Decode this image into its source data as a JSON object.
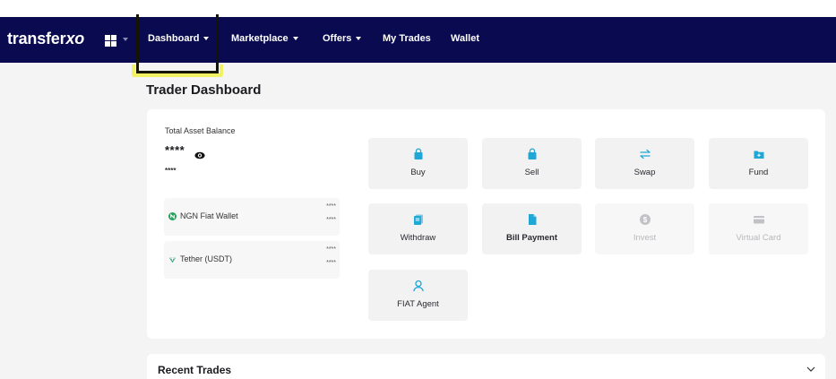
{
  "brand": {
    "name": "transfer",
    "accent": "xo"
  },
  "nav": {
    "items": [
      {
        "label": "Dashboard",
        "dropdown": true
      },
      {
        "label": "Marketplace",
        "dropdown": true
      },
      {
        "label": "Offers",
        "dropdown": true
      },
      {
        "label": "My Trades",
        "dropdown": false
      },
      {
        "label": "Wallet",
        "dropdown": false
      }
    ]
  },
  "page": {
    "title": "Trader Dashboard"
  },
  "balance": {
    "label": "Total Asset Balance",
    "masked_primary": "****",
    "masked_secondary": "****"
  },
  "wallets": [
    {
      "name": "NGN Fiat Wallet",
      "icon": "naira-icon",
      "value1": "****",
      "value2": "****"
    },
    {
      "name": "Tether (USDT)",
      "icon": "tether-icon",
      "value1": "****",
      "value2": "****"
    }
  ],
  "actions": [
    {
      "label": "Buy",
      "icon": "shopping-bag-icon",
      "enabled": true
    },
    {
      "label": "Sell",
      "icon": "shopping-bag-icon",
      "enabled": true
    },
    {
      "label": "Swap",
      "icon": "swap-arrows-icon",
      "enabled": true
    },
    {
      "label": "Fund",
      "icon": "folder-plus-icon",
      "enabled": true
    },
    {
      "label": "Withdraw",
      "icon": "document-stack-icon",
      "enabled": true
    },
    {
      "label": "Bill Payment",
      "icon": "document-icon",
      "enabled": true
    },
    {
      "label": "Invest",
      "icon": "dollar-coin-icon",
      "enabled": false
    },
    {
      "label": "Virtual Card",
      "icon": "credit-card-icon",
      "enabled": false
    },
    {
      "label": "FIAT Agent",
      "icon": "person-icon",
      "enabled": true
    }
  ],
  "recent": {
    "title": "Recent Trades"
  },
  "colors": {
    "navbar": "#0a0a50",
    "accent": "#1fa7d6",
    "highlight": "#f1f24a",
    "background": "#f4f4f5"
  }
}
